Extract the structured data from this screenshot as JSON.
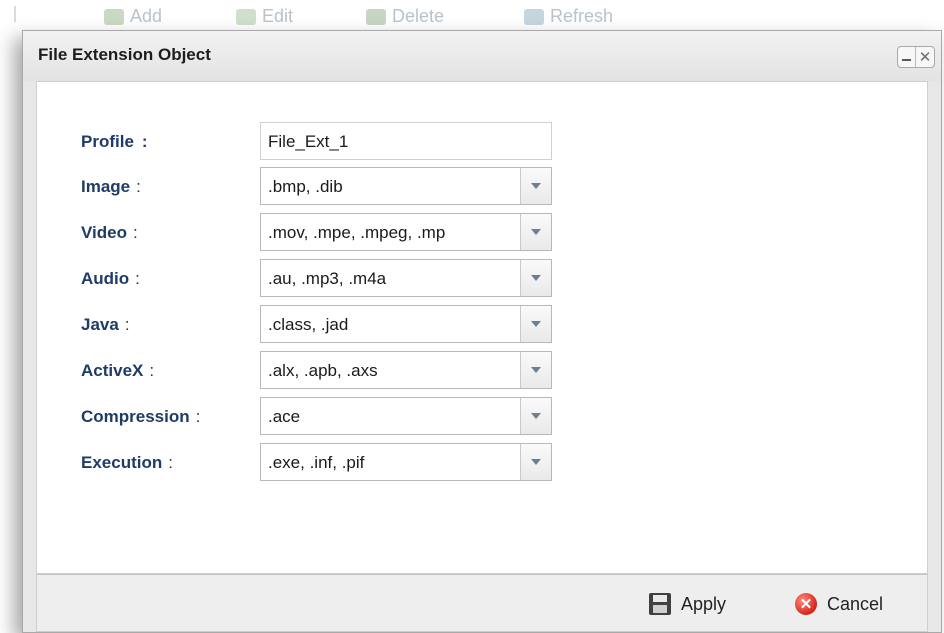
{
  "toolbar": {
    "add_label": "Add",
    "edit_label": "Edit",
    "delete_label": "Delete",
    "refresh_label": "Refresh"
  },
  "dialog": {
    "title": "File Extension Object",
    "minimize_icon": "minimize-icon",
    "close_icon": "close-icon"
  },
  "form": {
    "profile": {
      "label": "Profile",
      "colon": ":",
      "value": "File_Ext_1"
    },
    "fields": [
      {
        "label": "Image",
        "colon": ":",
        "value": ".bmp, .dib"
      },
      {
        "label": "Video",
        "colon": ":",
        "value": ".mov, .mpe, .mpeg, .mp"
      },
      {
        "label": "Audio",
        "colon": ":",
        "value": ".au, .mp3, .m4a"
      },
      {
        "label": "Java",
        "colon": ":",
        "value": ".class, .jad"
      },
      {
        "label": "ActiveX",
        "colon": ":",
        "value": ".alx, .apb, .axs"
      },
      {
        "label": "Compression",
        "colon": ":",
        "value": ".ace"
      },
      {
        "label": "Execution",
        "colon": ":",
        "value": ".exe, .inf, .pif"
      }
    ]
  },
  "footer": {
    "apply_label": "Apply",
    "cancel_label": "Cancel"
  },
  "colors": {
    "label_blue": "#1f3b68",
    "cancel_red": "#d6261b"
  }
}
